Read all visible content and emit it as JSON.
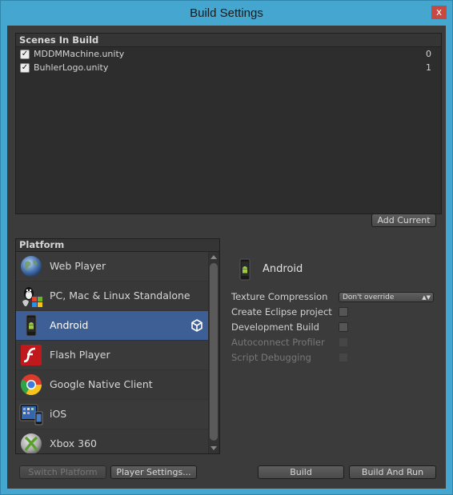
{
  "window": {
    "title": "Build Settings",
    "close_glyph": "x"
  },
  "scenes": {
    "header": "Scenes In Build",
    "items": [
      {
        "name": "MDDMMachine.unity",
        "index": "0",
        "checked": true
      },
      {
        "name": "BuhlerLogo.unity",
        "index": "1",
        "checked": true
      }
    ],
    "add_current_label": "Add Current"
  },
  "platform": {
    "header": "Platform",
    "items": [
      {
        "label": "Web Player",
        "icon": "web-player-icon"
      },
      {
        "label": "PC, Mac & Linux Standalone",
        "icon": "standalone-icon"
      },
      {
        "label": "Android",
        "icon": "android-icon",
        "selected": true
      },
      {
        "label": "Flash Player",
        "icon": "flash-icon"
      },
      {
        "label": "Google Native Client",
        "icon": "chrome-icon"
      },
      {
        "label": "iOS",
        "icon": "ios-icon"
      },
      {
        "label": "Xbox 360",
        "icon": "xbox-icon"
      }
    ]
  },
  "settings": {
    "title": "Android",
    "texture_compression_label": "Texture Compression",
    "texture_compression_value": "Don't override",
    "create_eclipse_label": "Create Eclipse project",
    "development_build_label": "Development Build",
    "autoconnect_profiler_label": "Autoconnect Profiler",
    "script_debugging_label": "Script Debugging"
  },
  "footer": {
    "switch_platform_label": "Switch Platform",
    "player_settings_label": "Player Settings...",
    "build_label": "Build",
    "build_and_run_label": "Build And Run"
  },
  "colors": {
    "title_bar": "#45a7cf",
    "close_button": "#c9483f",
    "panel_bg": "#3b3b3b",
    "selection": "#3e5f96"
  }
}
